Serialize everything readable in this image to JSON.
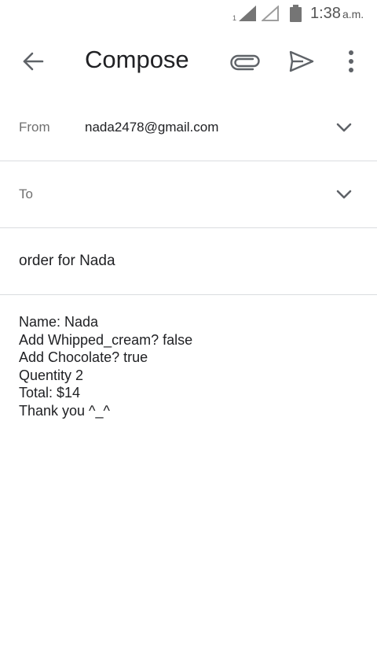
{
  "status_bar": {
    "sim_label": "1",
    "time": "1:38",
    "ampm": "a.m."
  },
  "toolbar": {
    "title": "Compose",
    "icons": [
      "arrow-back-icon",
      "paperclip-icon",
      "send-icon",
      "more-vert-icon"
    ]
  },
  "from": {
    "label": "From",
    "value": "nada2478@gmail.com"
  },
  "to": {
    "label": "To",
    "value": ""
  },
  "subject": {
    "value": "order for Nada"
  },
  "body": {
    "lines": [
      "Name: Nada",
      "Add Whipped_cream? false",
      "Add Chocolate? true",
      "Quentity 2",
      "Total: $14",
      "Thank you ^_^"
    ]
  }
}
